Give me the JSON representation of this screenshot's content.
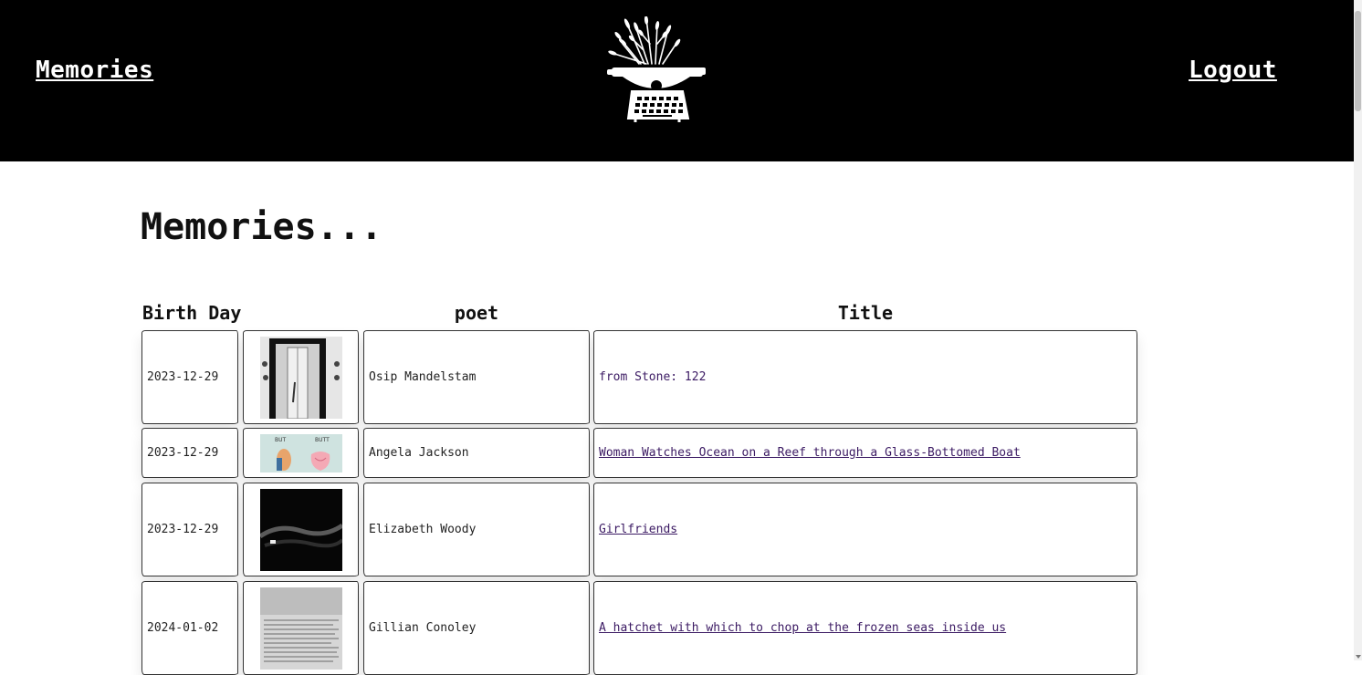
{
  "header": {
    "left_link": "Memories",
    "right_link": "Logout",
    "logo_icon": "typewriter-with-flowers-icon"
  },
  "main": {
    "title": "Memories...",
    "columns": {
      "birth_day": "Birth Day",
      "poet": "poet",
      "title": "Title"
    },
    "rows": [
      {
        "date": "2023-12-29",
        "poet": "Osip Mandelstam",
        "title": "from Stone: 122",
        "thumb_label": "",
        "thumb_icon": "doorway-photo"
      },
      {
        "date": "2023-12-29",
        "poet": "Angela Jackson",
        "title": "Woman Watches Ocean on a Reef through a Glass-Bottomed Boat",
        "thumb_label": "BUT",
        "thumb_label_2": "BUTT",
        "thumb_icon": "illustration-comparison"
      },
      {
        "date": "2023-12-29",
        "poet": "Elizabeth Woody",
        "title": "Girlfriends",
        "thumb_label": "",
        "thumb_icon": "dark-water-photo"
      },
      {
        "date": "2024-01-02",
        "poet": "Gillian Conoley",
        "title": "A hatchet with which to chop at the frozen seas inside us",
        "thumb_label": "",
        "thumb_icon": "text-page-photo"
      }
    ]
  },
  "colors": {
    "header_bg": "#000000",
    "link_visited": "#3b1a63"
  }
}
